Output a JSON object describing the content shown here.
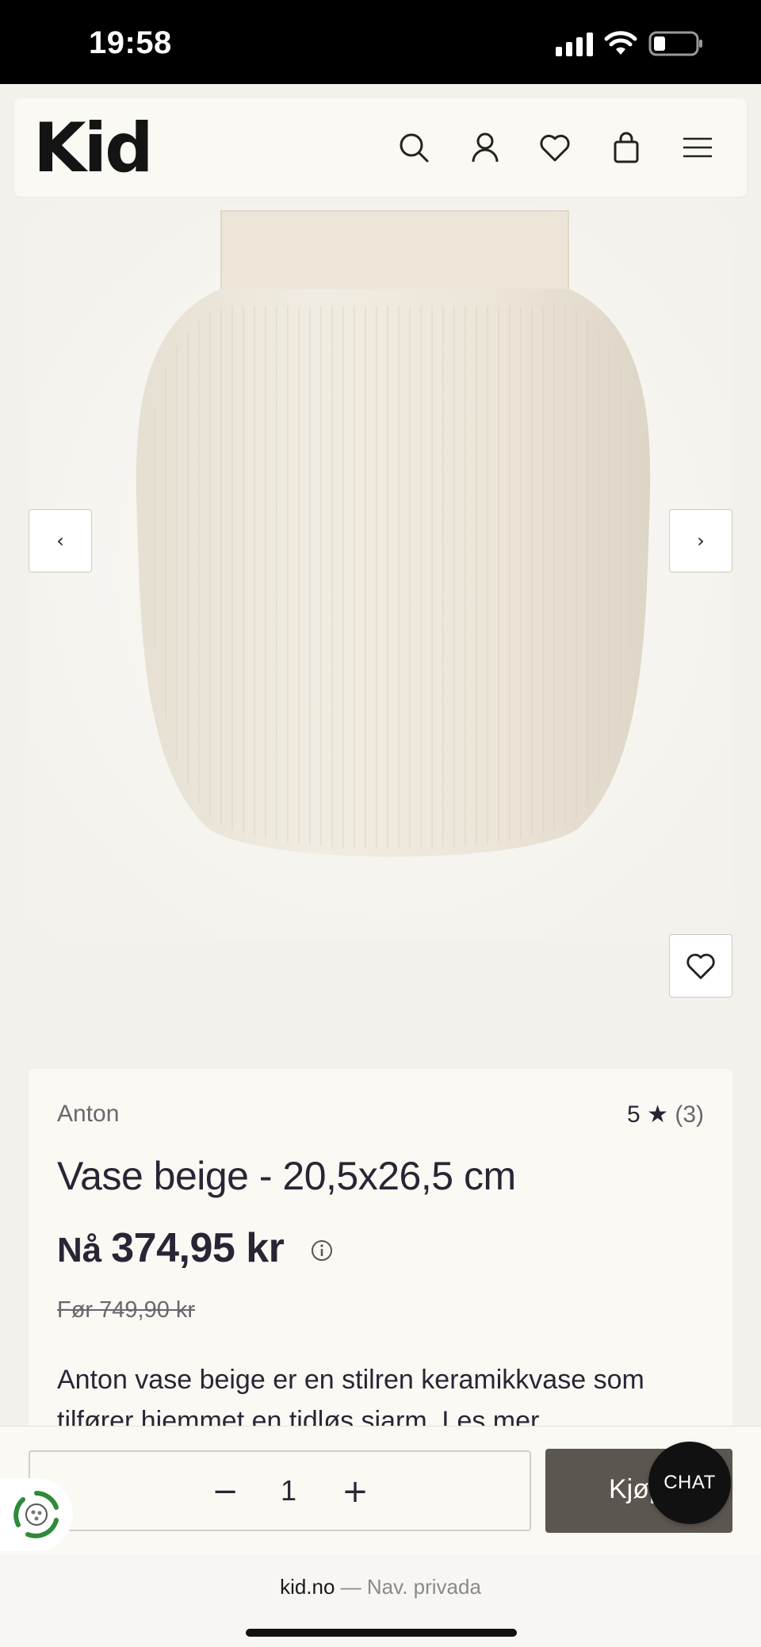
{
  "status_bar": {
    "time": "19:58"
  },
  "header": {
    "logo_text": "Kid",
    "icons": [
      "search-icon",
      "account-icon",
      "wishlist-heart-icon",
      "cart-bag-icon",
      "menu-icon"
    ]
  },
  "gallery": {
    "prev_label": "‹",
    "next_label": "›",
    "image_alt": "vase-product-image"
  },
  "product": {
    "brand": "Anton",
    "rating_value": "5",
    "rating_star": "★",
    "rating_count": "(3)",
    "title": "Vase beige - 20,5x26,5 cm",
    "price_prefix": "Nå",
    "price": "374,95 kr",
    "old_price": "Før 749,90 kr",
    "description": "Anton vase beige er en stilren keramikkvase som tilfører hjemmet en tidløs sjarm. Les mer"
  },
  "purchase": {
    "quantity": "1",
    "minus": "−",
    "plus": "+",
    "buy_label": "Kjøp"
  },
  "chat": {
    "label": "CHAT"
  },
  "browser": {
    "domain": "kid.no",
    "mode": " — Nav. privada"
  },
  "colors": {
    "page_bg": "#f3f1ec",
    "card_bg": "#fbf9f4",
    "text": "#2a2535",
    "muted": "#6a6670",
    "buy_button": "#5c5650",
    "chat_button": "#111111",
    "eco_green": "#2e8b3a"
  }
}
